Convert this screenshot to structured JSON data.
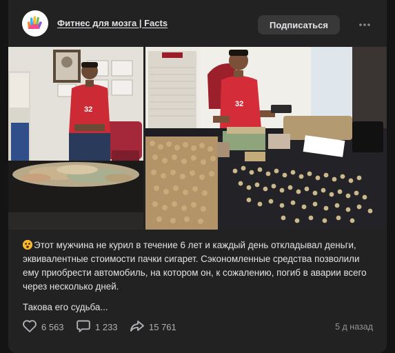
{
  "post": {
    "author": "Фитнес для мозга | Facts",
    "subscribe_label": "Подписаться",
    "paragraph1": "Этот мужчина не курил в течение 6 лет и каждый день откладывал деньги, эквивалентные стоимости пачки сигарет. Сэкономленные средства позволили ему приобрести автомобиль, на котором он, к сожалению, погиб в аварии всего через несколько дней.",
    "paragraph2": "Такова его судьба...",
    "likes": "6 563",
    "comments": "1 233",
    "shares": "15 761",
    "timestamp": "5 д назад"
  },
  "colors": {
    "page_bg": "#141414",
    "card_bg": "#222222",
    "button_bg": "#383838",
    "text": "#e1e3e6",
    "muted": "#939393"
  },
  "icons": [
    "ellipsis-icon",
    "heart-icon",
    "comment-icon",
    "share-icon",
    "astonished-face-emoji"
  ]
}
